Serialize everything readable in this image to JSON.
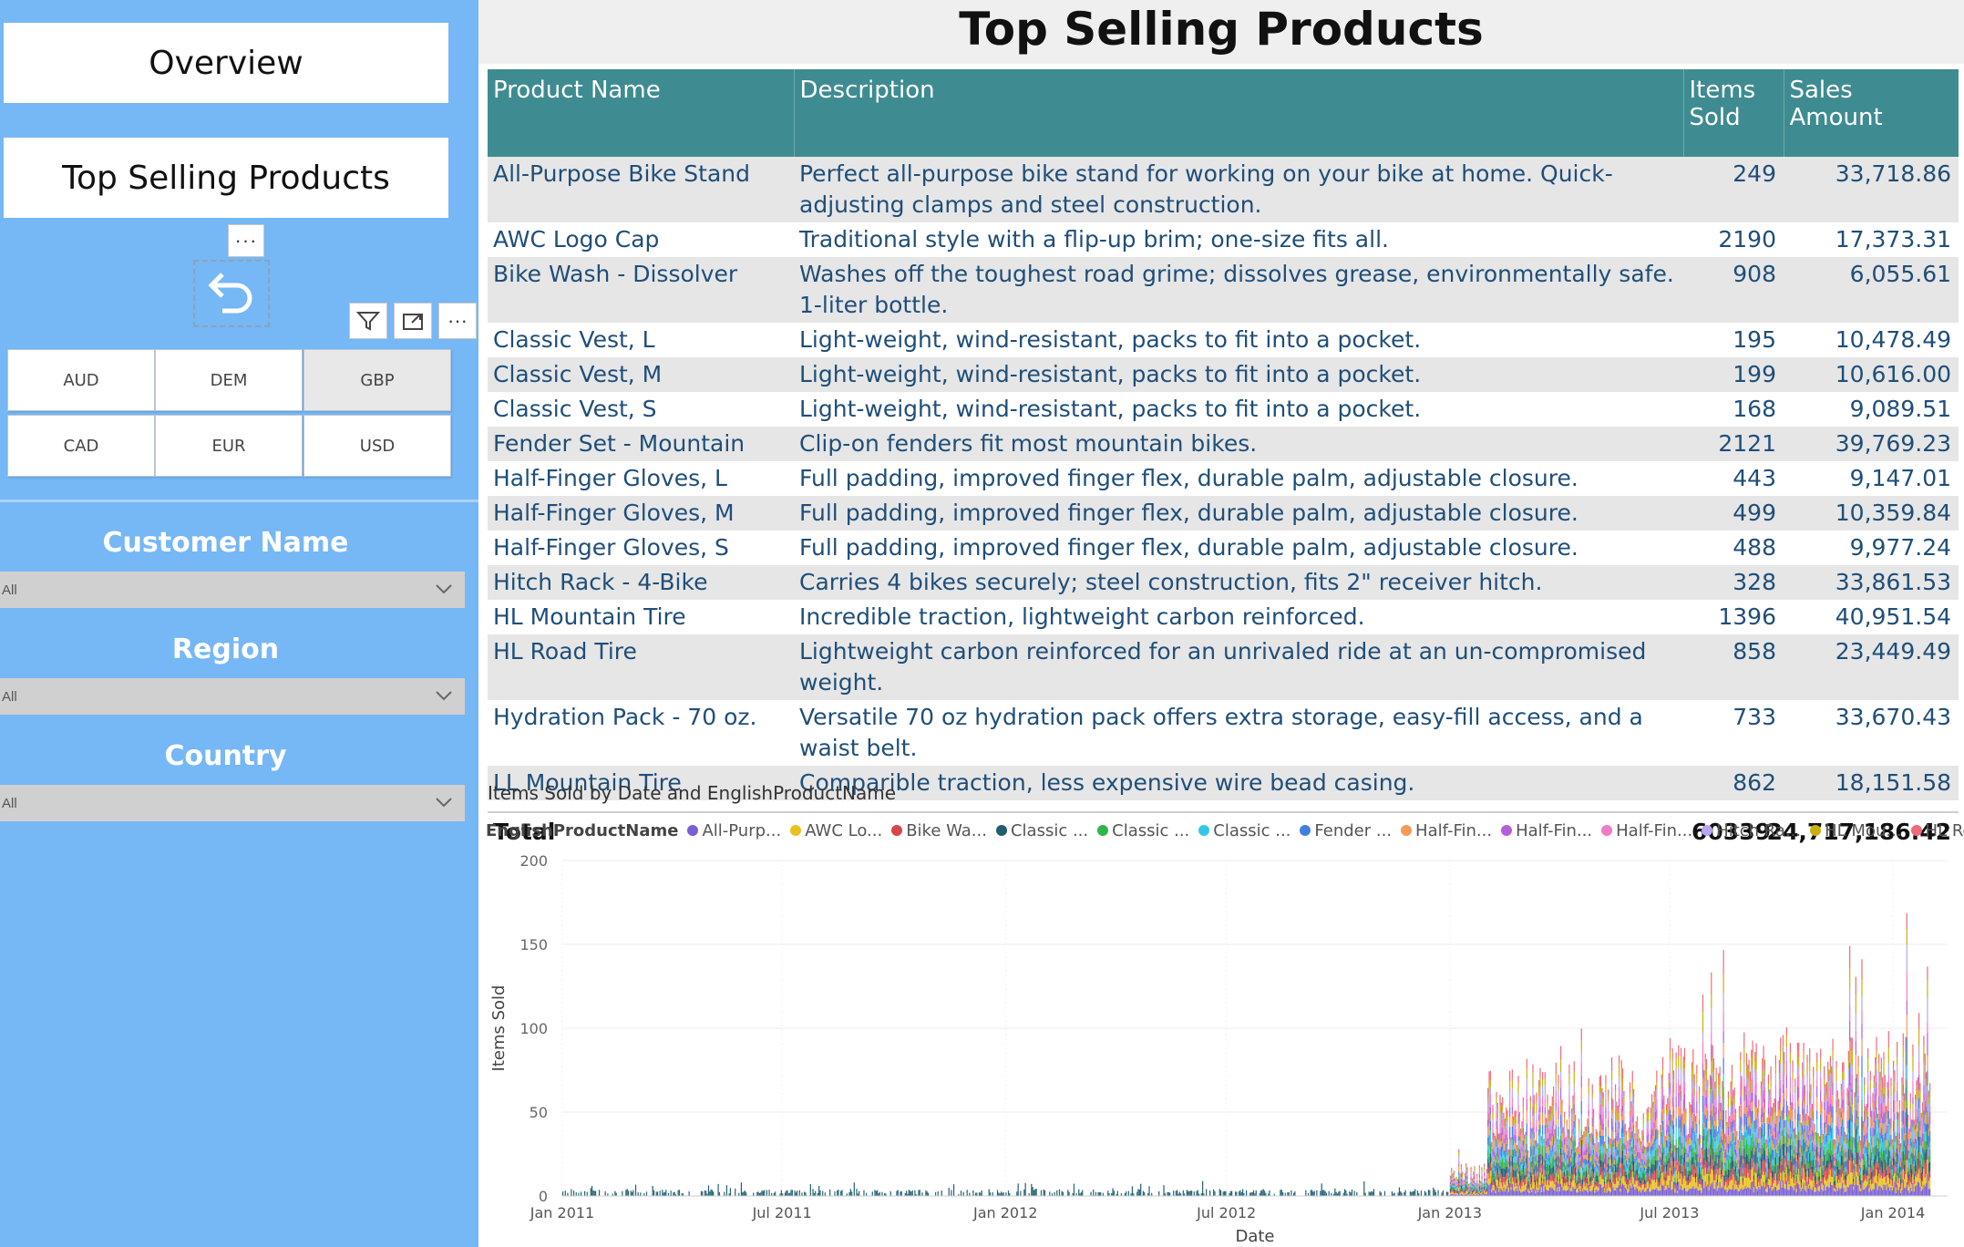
{
  "sidebar": {
    "nav_overview": "Overview",
    "nav_top_selling": "Top Selling Products",
    "more_label": "···",
    "currencies": [
      "AUD",
      "DEM",
      "GBP",
      "CAD",
      "EUR",
      "USD"
    ],
    "selected_currency": "GBP",
    "slicers": [
      {
        "title": "Customer Name",
        "value": "All"
      },
      {
        "title": "Region",
        "value": "All"
      },
      {
        "title": "Country",
        "value": "All"
      }
    ]
  },
  "page": {
    "title": "Top Selling Products"
  },
  "table": {
    "headers": [
      "Product Name",
      "Description",
      "Items Sold",
      "Sales Amount"
    ],
    "rows": [
      [
        "All-Purpose Bike Stand",
        "Perfect all-purpose bike stand for working on your bike at home. Quick-adjusting clamps and steel construction.",
        "249",
        "33,718.86"
      ],
      [
        "AWC Logo Cap",
        "Traditional style with a flip-up brim; one-size fits all.",
        "2190",
        "17,373.31"
      ],
      [
        "Bike Wash - Dissolver",
        "Washes off the toughest road grime; dissolves grease, environmentally safe. 1-liter bottle.",
        "908",
        "6,055.61"
      ],
      [
        "Classic Vest, L",
        "Light-weight, wind-resistant, packs to fit into a pocket.",
        "195",
        "10,478.49"
      ],
      [
        "Classic Vest, M",
        "Light-weight, wind-resistant, packs to fit into a pocket.",
        "199",
        "10,616.00"
      ],
      [
        "Classic Vest, S",
        "Light-weight, wind-resistant, packs to fit into a pocket.",
        "168",
        "9,089.51"
      ],
      [
        "Fender Set - Mountain",
        "Clip-on fenders fit most mountain bikes.",
        "2121",
        "39,769.23"
      ],
      [
        "Half-Finger Gloves, L",
        "Full padding, improved finger flex, durable palm, adjustable closure.",
        "443",
        "9,147.01"
      ],
      [
        "Half-Finger Gloves, M",
        "Full padding, improved finger flex, durable palm, adjustable closure.",
        "499",
        "10,359.84"
      ],
      [
        "Half-Finger Gloves, S",
        "Full padding, improved finger flex, durable palm, adjustable closure.",
        "488",
        "9,977.24"
      ],
      [
        "Hitch Rack - 4-Bike",
        "Carries 4 bikes securely; steel construction, fits 2\" receiver hitch.",
        "328",
        "33,861.53"
      ],
      [
        "HL Mountain Tire",
        "Incredible traction, lightweight carbon reinforced.",
        "1396",
        "40,951.54"
      ],
      [
        "HL Road Tire",
        "Lightweight carbon reinforced for an unrivaled ride at an un-compromised weight.",
        "858",
        "23,449.49"
      ],
      [
        "Hydration Pack - 70 oz.",
        "Versatile 70 oz hydration pack offers extra storage, easy-fill access, and a waist belt.",
        "733",
        "33,670.43"
      ],
      [
        "LL Mountain Tire",
        "Comparible traction, less expensive wire bead casing.",
        "862",
        "18,151.58"
      ]
    ],
    "total": {
      "label": "Total",
      "items": "60339",
      "amount": "24,717,186.42"
    }
  },
  "chart": {
    "title": "Items Sold by Date and EnglishProductName",
    "legend_title": "EnglishProductName",
    "legend": [
      {
        "label": "All-Purp...",
        "color": "#7b5fd6"
      },
      {
        "label": "AWC Lo...",
        "color": "#e8c21e"
      },
      {
        "label": "Bike Wa...",
        "color": "#d64550"
      },
      {
        "label": "Classic ...",
        "color": "#1f5e6e"
      },
      {
        "label": "Classic ...",
        "color": "#2fb54a"
      },
      {
        "label": "Classic ...",
        "color": "#35c7e8"
      },
      {
        "label": "Fender ...",
        "color": "#3f7fe0"
      },
      {
        "label": "Half-Fin...",
        "color": "#f39a5a"
      },
      {
        "label": "Half-Fin...",
        "color": "#b35fd6"
      },
      {
        "label": "Half-Fin...",
        "color": "#f27ac8"
      },
      {
        "label": "Hitch Ra...",
        "color": "#b8a7f0"
      },
      {
        "label": "HL Mou...",
        "color": "#c8b010"
      },
      {
        "label": "HL Road ...",
        "color": "#f06a7a"
      }
    ]
  },
  "chart_data": {
    "type": "bar",
    "title": "Items Sold by Date and EnglishProductName",
    "xlabel": "Date",
    "ylabel": "Items Sold",
    "ylim": [
      0,
      200
    ],
    "y_ticks": [
      0,
      50,
      100,
      150,
      200
    ],
    "x_tick_labels": [
      "Jan 2011",
      "Jul 2011",
      "Jan 2012",
      "Jul 2012",
      "Jan 2013",
      "Jul 2013",
      "Jan 2014"
    ],
    "x_range": [
      "2011-01-01",
      "2014-01-31"
    ],
    "stacked": true,
    "legend_title": "EnglishProductName",
    "legend_position": "top",
    "series_names": [
      "All-Purp...",
      "AWC Lo...",
      "Bike Wa...",
      "Classic ...",
      "Classic ...",
      "Classic ...",
      "Fender ...",
      "Half-Fin...",
      "Half-Fin...",
      "Half-Fin...",
      "Hitch Ra...",
      "HL Mou...",
      "HL Road ..."
    ],
    "approx_daily_totals": [
      {
        "period": "2011-01 to 2012-12",
        "typical": 3,
        "max": 8
      },
      {
        "period": "2013-01",
        "typical": 15,
        "max": 30
      },
      {
        "period": "2013-02 to 2013-06",
        "typical": 60,
        "max": 95
      },
      {
        "period": "2013-07 to 2013-12",
        "typical": 70,
        "max": 145
      },
      {
        "period": "2014-01",
        "typical": 75,
        "max": 160
      }
    ]
  }
}
